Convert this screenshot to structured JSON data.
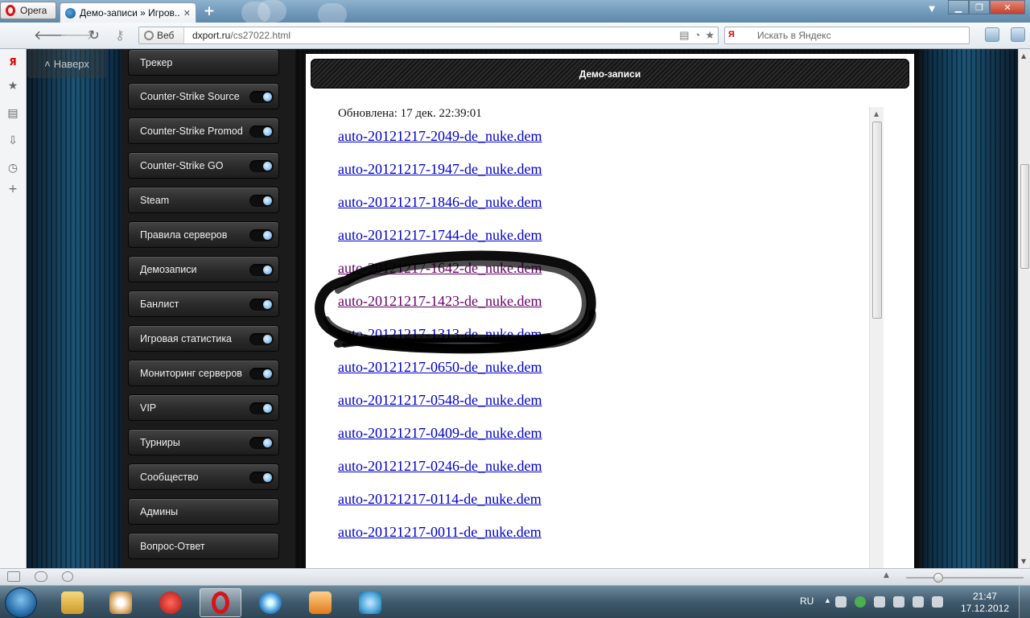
{
  "browser": {
    "opera_button": "Opera",
    "active_tab": {
      "title": "Демо-записи » Игров...",
      "close": "✕"
    },
    "new_tab": "+",
    "address": {
      "badge": "Веб",
      "host": "dxport.ru",
      "path": "/cs27022.html"
    },
    "search": {
      "engine": "Я",
      "placeholder": "Искать в Яндекс"
    }
  },
  "page": {
    "scroll_top": "Наверх",
    "menu": [
      {
        "label": "Трекер",
        "toggle": false
      },
      {
        "label": "Counter-Strike Source",
        "toggle": true
      },
      {
        "label": "Counter-Strike Promod",
        "toggle": true
      },
      {
        "label": "Counter-Strike GO",
        "toggle": true
      },
      {
        "label": "Steam",
        "toggle": true
      },
      {
        "label": "Правила серверов",
        "toggle": true
      },
      {
        "label": "Демозаписи",
        "toggle": true
      },
      {
        "label": "Банлист",
        "toggle": true
      },
      {
        "label": "Игровая статистика",
        "toggle": true
      },
      {
        "label": "Мониторинг серверов",
        "toggle": true
      },
      {
        "label": "VIP",
        "toggle": true
      },
      {
        "label": "Турниры",
        "toggle": true
      },
      {
        "label": "Сообщество",
        "toggle": true
      },
      {
        "label": "Админы",
        "toggle": false
      },
      {
        "label": "Вопрос-Ответ",
        "toggle": false
      }
    ],
    "header": "Демо-записи",
    "updated": "Обновлена: 17 дек. 22:39:01",
    "demos": [
      {
        "name": "auto-20121217-2049-de_nuke.dem",
        "visited": false
      },
      {
        "name": "auto-20121217-1947-de_nuke.dem",
        "visited": false
      },
      {
        "name": "auto-20121217-1846-de_nuke.dem",
        "visited": false
      },
      {
        "name": "auto-20121217-1744-de_nuke.dem",
        "visited": false
      },
      {
        "name": "auto-20121217-1642-de_nuke.dem",
        "visited": true
      },
      {
        "name": "auto-20121217-1423-de_nuke.dem",
        "visited": true
      },
      {
        "name": "auto-20121217-1313-de_nuke.dem",
        "visited": false
      },
      {
        "name": "auto-20121217-0650-de_nuke.dem",
        "visited": false
      },
      {
        "name": "auto-20121217-0548-de_nuke.dem",
        "visited": false
      },
      {
        "name": "auto-20121217-0409-de_nuke.dem",
        "visited": false
      },
      {
        "name": "auto-20121217-0246-de_nuke.dem",
        "visited": false
      },
      {
        "name": "auto-20121217-0114-de_nuke.dem",
        "visited": false
      },
      {
        "name": "auto-20121217-0011-de_nuke.dem",
        "visited": false
      }
    ]
  },
  "taskbar": {
    "lang": "RU",
    "time": "21:47",
    "date": "17.12.2012"
  },
  "colors": {
    "link": "#0000cc",
    "visited": "#660066",
    "opera_red": "#d7141a"
  }
}
